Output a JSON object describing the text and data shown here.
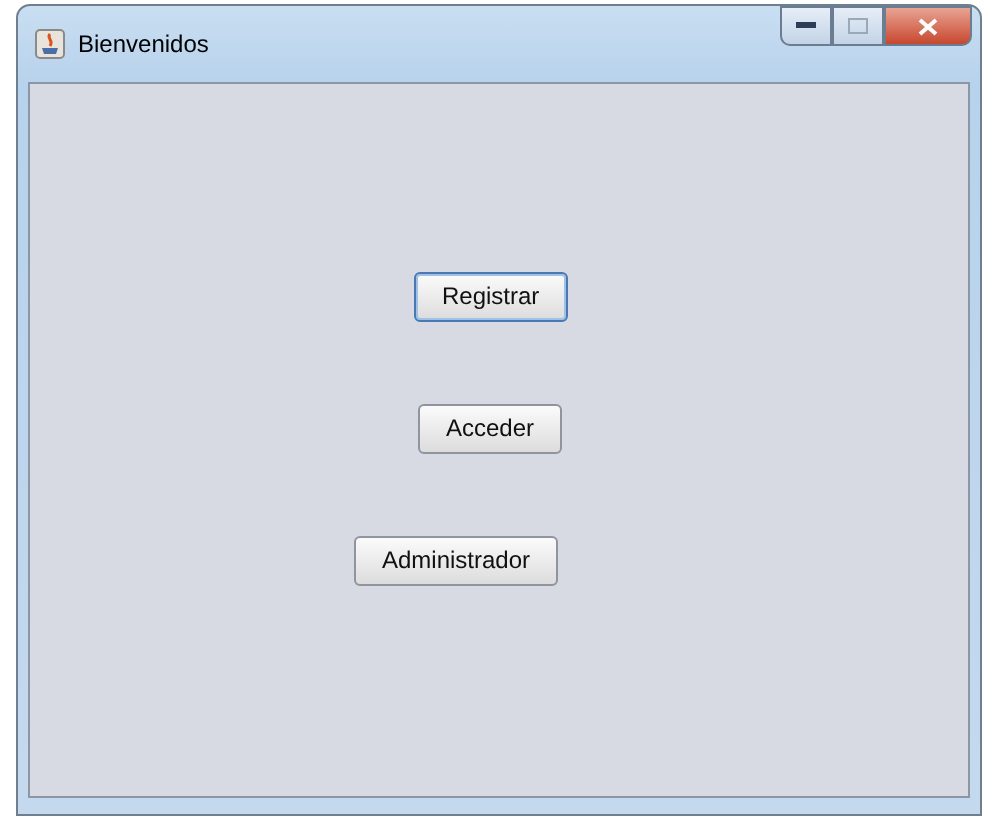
{
  "window": {
    "title": "Bienvenidos"
  },
  "buttons": [
    {
      "label": "Registrar",
      "focused": true
    },
    {
      "label": "Acceder",
      "focused": false
    },
    {
      "label": "Administrador",
      "focused": false
    }
  ]
}
